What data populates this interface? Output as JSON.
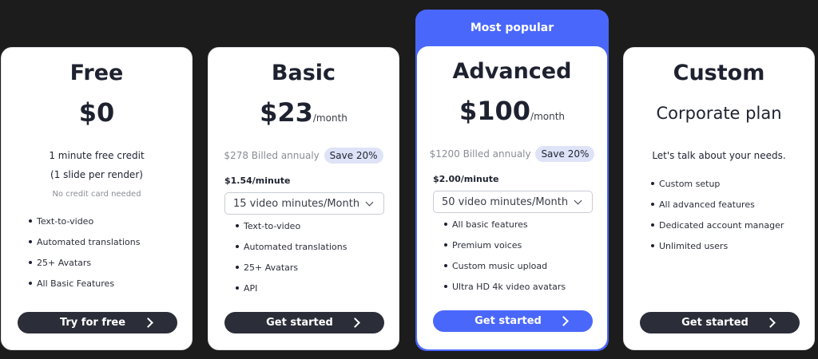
{
  "colors": {
    "accent": "#4a67fb",
    "dark_button": "#2b2e38",
    "badge_bg": "#dfe3f7",
    "page_bg": "#1c1c1c"
  },
  "free": {
    "name": "Free",
    "price": "$0",
    "credit_line1": "1 minute free credit",
    "credit_line2": "(1 slide per render)",
    "note": "No credit card needed",
    "features": [
      "Text-to-video",
      "Automated translations",
      "25+ Avatars",
      "All Basic Features"
    ],
    "cta": "Try for free"
  },
  "basic": {
    "name": "Basic",
    "price": "$23",
    "period": "/month",
    "billed": "$278 Billed annualy",
    "save": "Save 20%",
    "per_minute": "$1.54/minute",
    "select_value": "15 video minutes/Month",
    "features": [
      "Text-to-video",
      "Automated translations",
      "25+ Avatars",
      "API"
    ],
    "cta": "Get started"
  },
  "advanced": {
    "banner": "Most popular",
    "name": "Advanced",
    "price": "$100",
    "period": "/month",
    "billed": "$1200 Billed annualy",
    "save": "Save 20%",
    "per_minute": "$2.00/minute",
    "select_value": "50 video minutes/Month",
    "features": [
      "All basic features",
      "Premium voices",
      "Custom music upload",
      "Ultra HD 4k video avatars"
    ],
    "cta": "Get started"
  },
  "custom": {
    "name": "Custom",
    "subtitle": "Corporate plan",
    "tagline": "Let's talk about your needs.",
    "features": [
      "Custom setup",
      "All advanced features",
      "Dedicated account manager",
      "Unlimited users"
    ],
    "cta": "Get started"
  }
}
